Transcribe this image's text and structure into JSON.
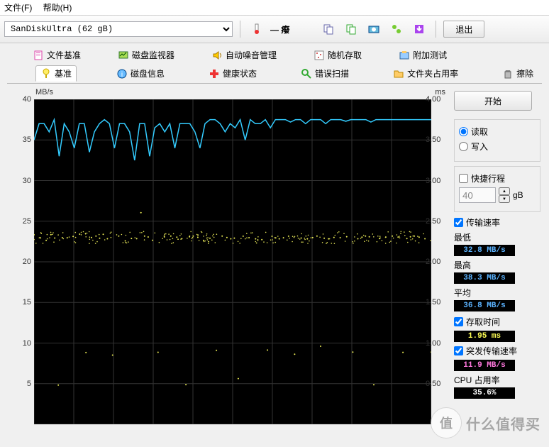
{
  "menu": {
    "file": "文件(F)",
    "help": "帮助(H)"
  },
  "toolbar": {
    "drive": "SanDiskUltra (62 gB)",
    "exit": "退出"
  },
  "tabs_row1": [
    {
      "icon": "file-base",
      "label": "文件基准"
    },
    {
      "icon": "disk-monitor",
      "label": "磁盘监视器"
    },
    {
      "icon": "auto-noise",
      "label": "自动噪音管理"
    },
    {
      "icon": "random-access",
      "label": "随机存取"
    },
    {
      "icon": "addon-test",
      "label": "附加测试"
    }
  ],
  "tabs_row2": [
    {
      "icon": "benchmark",
      "label": "基准",
      "active": true
    },
    {
      "icon": "disk-info",
      "label": "磁盘信息"
    },
    {
      "icon": "health",
      "label": "健康状态"
    },
    {
      "icon": "error-scan",
      "label": "错误扫描"
    },
    {
      "icon": "folder-usage",
      "label": "文件夹占用率"
    },
    {
      "icon": "erase",
      "label": "擦除"
    }
  ],
  "chart": {
    "y_left_unit": "MB/s",
    "y_right_unit": "ms",
    "y_left_ticks": [
      "40",
      "35",
      "30",
      "25",
      "20",
      "15",
      "10",
      "5"
    ],
    "y_right_ticks": [
      "4.00",
      "3.50",
      "3.00",
      "2.50",
      "2.00",
      "1.50",
      "1.00",
      "0.50"
    ]
  },
  "panel": {
    "start": "开始",
    "read": "读取",
    "write": "写入",
    "quick": "快捷行程",
    "quick_val": "40",
    "quick_unit": "gB",
    "transfer_rate": "传输速率",
    "min_lbl": "最低",
    "min_val": "32.8 MB/s",
    "max_lbl": "最高",
    "max_val": "38.3 MB/s",
    "avg_lbl": "平均",
    "avg_val": "36.8 MB/s",
    "access_lbl": "存取时间",
    "access_val": "1.95 ms",
    "burst_lbl": "突发传输速率",
    "burst_val": "11.9 MB/s",
    "cpu_lbl": "CPU 占用率",
    "cpu_val": "35.6%"
  },
  "watermark": {
    "glyph": "值",
    "text": "什么值得买"
  },
  "chart_data": {
    "type": "line",
    "title": "",
    "xlabel": "",
    "ylabel_left": "MB/s",
    "ylabel_right": "ms",
    "ylim_left": [
      0,
      40
    ],
    "ylim_right": [
      0,
      4.0
    ],
    "series": [
      {
        "name": "transfer_rate_line",
        "unit": "MB/s",
        "values": [
          35,
          37,
          37,
          36,
          37.5,
          33,
          37,
          36,
          34,
          37,
          37,
          33.5,
          36,
          37,
          37.5,
          37,
          34,
          37,
          37,
          36,
          32.5,
          37,
          37,
          33,
          36.5,
          37,
          36,
          37,
          34,
          37,
          37,
          37,
          36,
          34,
          37,
          37.5,
          37.5,
          37,
          36,
          37,
          36.5,
          37.5,
          35,
          37.5,
          37,
          37,
          37.5,
          36.5,
          37.5,
          37.5,
          37.5,
          37.2,
          37.5,
          37.5,
          37,
          37.5,
          37.5,
          37.5,
          37,
          37.5,
          37.5,
          37.5,
          37.3,
          37.5,
          37.5,
          37.5,
          37.5,
          37.2,
          37.5,
          37.5,
          37.5,
          37.5,
          37.5,
          37.5,
          37.5,
          37.5,
          37.5,
          37.5,
          37.5,
          37.5
        ]
      },
      {
        "name": "access_time_scatter",
        "unit": "ms",
        "values": [
          2.35,
          2.3,
          2.25,
          2.32,
          2.3,
          0.5,
          2.3,
          2.28,
          2.3,
          2.35,
          0.9,
          2.3,
          2.3,
          2.28,
          2.35,
          2.3,
          0.85,
          2.3,
          2.25,
          2.3,
          2.3,
          2.6,
          2.3,
          2.3,
          2.28,
          0.9,
          2.3,
          2.3,
          2.3,
          2.3,
          0.5,
          2.3,
          2.3,
          2.3,
          2.28,
          2.3,
          0.9,
          2.3,
          2.3,
          2.3,
          2.3,
          0.55,
          2.3,
          2.3,
          2.3,
          2.28,
          0.9,
          2.3,
          2.3,
          2.3,
          2.3,
          2.3,
          0.85,
          2.3,
          2.3,
          2.3,
          2.3,
          0.95,
          2.3,
          2.3,
          2.3,
          2.28,
          2.3,
          0.9,
          2.3,
          2.3,
          2.3,
          2.3,
          0.5,
          2.3,
          2.3,
          2.3,
          2.3,
          0.9,
          2.3,
          2.3,
          2.3,
          2.3,
          2.3,
          0.9
        ]
      }
    ]
  }
}
